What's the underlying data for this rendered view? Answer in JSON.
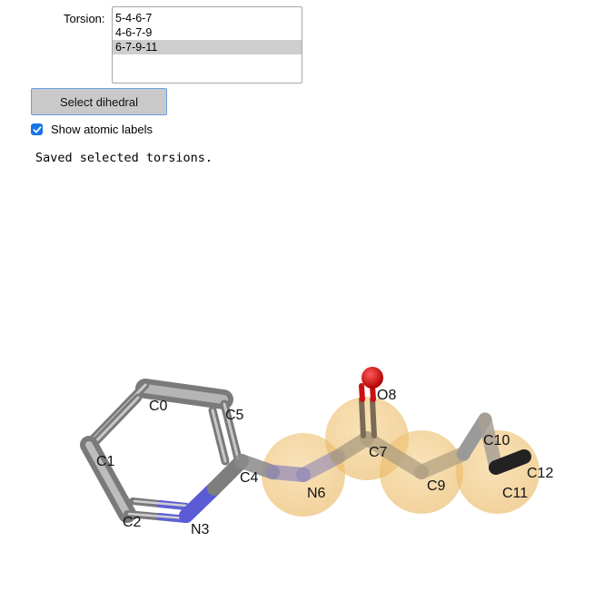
{
  "torsion": {
    "label": "Torsion:",
    "options": [
      "5-4-6-7",
      "4-6-7-9",
      "6-7-9-11"
    ],
    "selected_index": 2
  },
  "select_button": "Select dihedral",
  "show_labels": {
    "label": "Show atomic labels",
    "checked": true
  },
  "status_message": "Saved selected torsions.",
  "molecule": {
    "atom_labels": [
      "C0",
      "C1",
      "C2",
      "N3",
      "C4",
      "C5",
      "N6",
      "C7",
      "O8",
      "C9",
      "C10",
      "C11",
      "C12"
    ],
    "colors": {
      "carbon": "#8c8c8c",
      "nitrogen": "#6f6ff0",
      "oxygen": "#e00000",
      "highlight": "#f2c36b",
      "checkbox": "#1a73e8"
    }
  }
}
